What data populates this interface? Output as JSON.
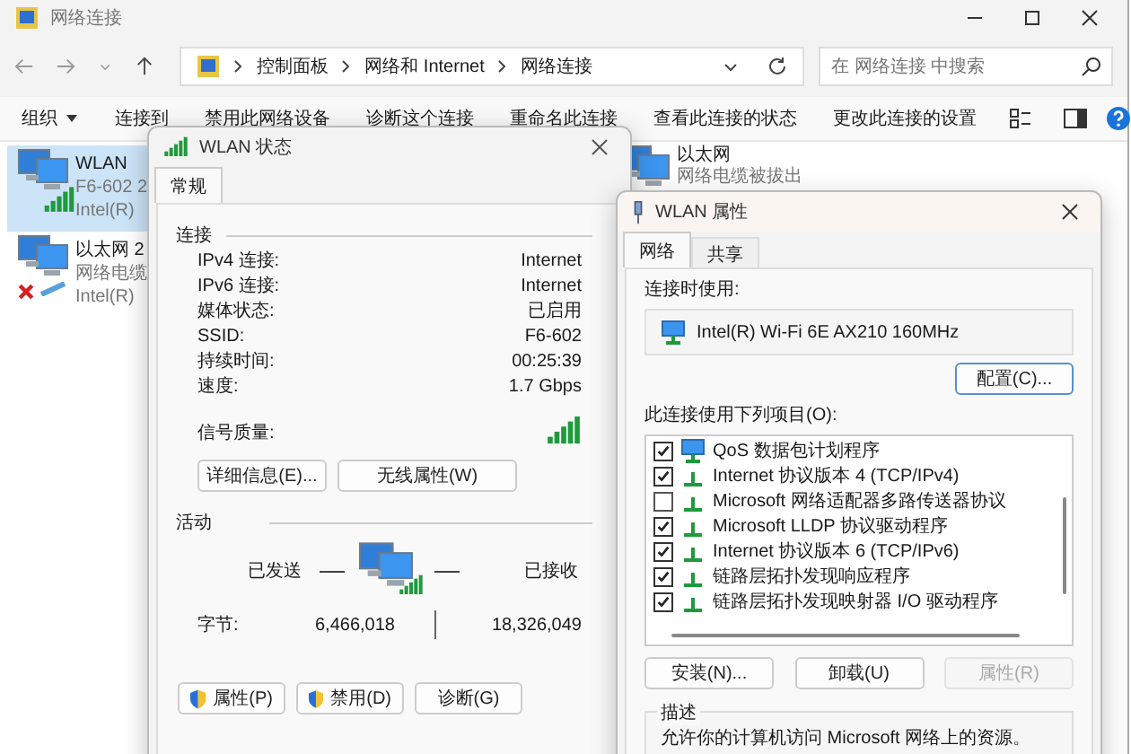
{
  "explorer": {
    "title": "网络连接",
    "breadcrumb": [
      "控制面板",
      "网络和 Internet",
      "网络连接"
    ],
    "search": {
      "placeholder": "在 网络连接 中搜索"
    },
    "commands": [
      {
        "label": "组织",
        "dropdown": true
      },
      {
        "label": "连接到",
        "dropdown": false
      },
      {
        "label": "禁用此网络设备",
        "dropdown": false
      },
      {
        "label": "诊断这个连接",
        "dropdown": false
      },
      {
        "label": "重命名此连接",
        "dropdown": false
      },
      {
        "label": "查看此连接的状态",
        "dropdown": false
      },
      {
        "label": "更改此连接的设置",
        "dropdown": false
      }
    ],
    "connections": [
      {
        "name": "WLAN",
        "lines": [
          "F6-602 2",
          "Intel(R)"
        ],
        "kind": "wifi",
        "selected": true
      },
      {
        "name": "以太网 2",
        "lines": [
          "网络电缆",
          "Intel(R)"
        ],
        "kind": "ethernet-unplugged",
        "selected": false
      },
      {
        "name": "以太网",
        "lines": [
          "网络电缆被拔出"
        ],
        "kind": "ethernet",
        "selected": false
      }
    ]
  },
  "status_dialog": {
    "title": "WLAN 状态",
    "tabs": [
      {
        "label": "常规",
        "selected": true
      }
    ],
    "connection_heading": "连接",
    "fields": [
      {
        "label": "IPv4 连接:",
        "value": "Internet",
        "kind": "text"
      },
      {
        "label": "IPv6 连接:",
        "value": "Internet",
        "kind": "text"
      },
      {
        "label": "媒体状态:",
        "value": "已启用",
        "kind": "text"
      },
      {
        "label": "SSID:",
        "value": "F6-602",
        "kind": "text"
      },
      {
        "label": "持续时间:",
        "value": "00:25:39",
        "kind": "text"
      },
      {
        "label": "速度:",
        "value": "1.7 Gbps",
        "kind": "text"
      },
      {
        "label": "信号质量:",
        "kind": "signal"
      }
    ],
    "detail_buttons": [
      "详细信息(E)...",
      "无线属性(W)"
    ],
    "activity_heading": "活动",
    "sent_label": "已发送",
    "received_label": "已接收",
    "bytes_label": "字节:",
    "bytes_sent": "6,466,018",
    "bytes_received": "18,326,049",
    "buttons": [
      {
        "label": "属性(P)",
        "shield": true
      },
      {
        "label": "禁用(D)",
        "shield": true
      },
      {
        "label": "诊断(G)",
        "shield": false
      }
    ]
  },
  "properties_dialog": {
    "title": "WLAN 属性",
    "tabs": [
      {
        "label": "网络",
        "selected": true
      },
      {
        "label": "共享",
        "selected": false
      }
    ],
    "connect_using_label": "连接时使用:",
    "adapter": "Intel(R) Wi-Fi 6E AX210 160MHz",
    "configure_button": "配置(C)...",
    "items_label": "此连接使用下列项目(O):",
    "items": [
      {
        "label": "QoS 数据包计划程序",
        "checked": true,
        "kind": "service"
      },
      {
        "label": "Internet 协议版本 4 (TCP/IPv4)",
        "checked": true,
        "kind": "protocol"
      },
      {
        "label": "Microsoft 网络适配器多路传送器协议",
        "checked": false,
        "kind": "protocol"
      },
      {
        "label": "Microsoft LLDP 协议驱动程序",
        "checked": true,
        "kind": "protocol"
      },
      {
        "label": "Internet 协议版本 6 (TCP/IPv6)",
        "checked": true,
        "kind": "protocol"
      },
      {
        "label": "链路层拓扑发现响应程序",
        "checked": true,
        "kind": "protocol"
      },
      {
        "label": "链路层拓扑发现映射器 I/O 驱动程序",
        "checked": true,
        "kind": "protocol"
      }
    ],
    "buttons": [
      {
        "label": "安装(N)...",
        "disabled": false
      },
      {
        "label": "卸载(U)",
        "disabled": false
      },
      {
        "label": "属性(R)",
        "disabled": true
      }
    ],
    "description_heading": "描述",
    "description": "允许你的计算机访问 Microsoft 网络上的资源。"
  }
}
